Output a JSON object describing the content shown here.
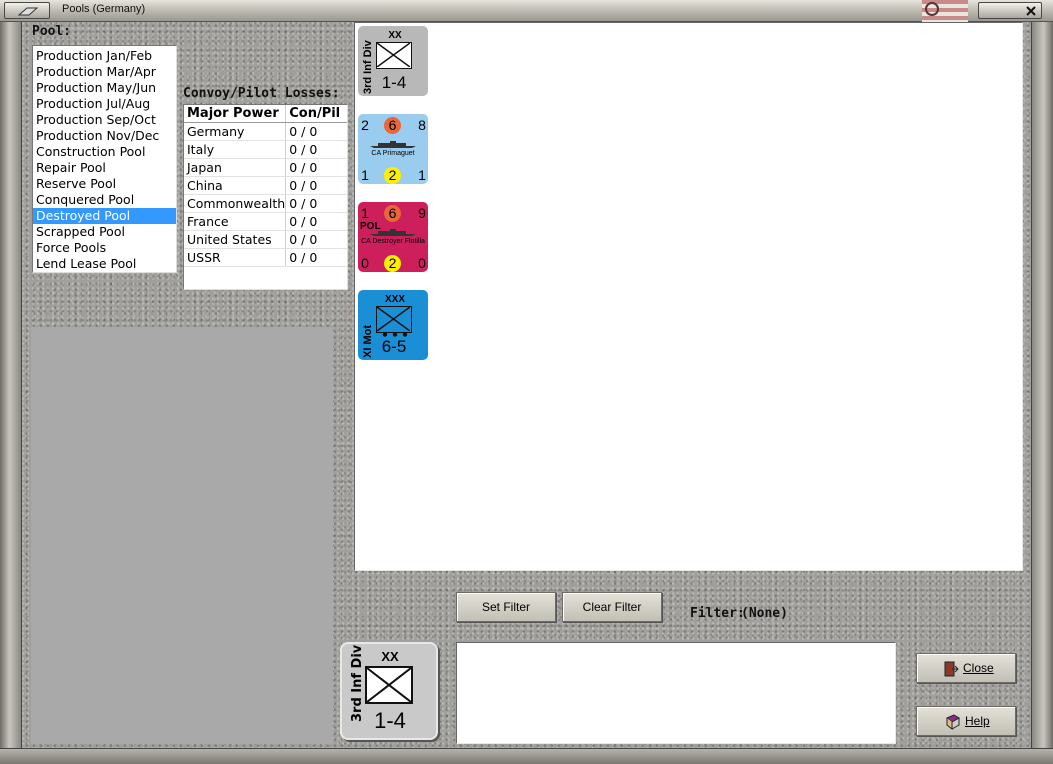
{
  "window": {
    "title": "Pools (Germany)"
  },
  "pool": {
    "label": "Pool:",
    "items": [
      "Production Jan/Feb",
      "Production Mar/Apr",
      "Production May/Jun",
      "Production Jul/Aug",
      "Production Sep/Oct",
      "Production Nov/Dec",
      "Construction Pool",
      "Repair Pool",
      "Reserve Pool",
      "Conquered Pool",
      "Destroyed Pool",
      "Scrapped Pool",
      "Force Pools",
      "Lend Lease Pool"
    ],
    "selected": "Destroyed Pool"
  },
  "convoy": {
    "label": "Convoy/Pilot Losses:",
    "headers": [
      "Major Power",
      "Con/Pil"
    ],
    "rows": [
      [
        "Germany",
        "0 / 0"
      ],
      [
        "Italy",
        "0 / 0"
      ],
      [
        "Japan",
        "0 / 0"
      ],
      [
        "China",
        "0 / 0"
      ],
      [
        "Commonwealth",
        "0 / 0"
      ],
      [
        "France",
        "0 / 0"
      ],
      [
        "United States",
        "0 / 0"
      ],
      [
        "USSR",
        "0 / 0"
      ]
    ]
  },
  "units": [
    {
      "kind": "land",
      "name": "3rd Inf Div",
      "size": "XX",
      "strength": "1-4",
      "color": "#b8b8b8",
      "symbol_bg": "#ffffff"
    },
    {
      "kind": "naval",
      "name": "CA Primaguet",
      "tl": "2",
      "tc": "6",
      "tr": "8",
      "bl": "1",
      "bc": "2",
      "br": "1",
      "color": "#99ccee",
      "flag": ""
    },
    {
      "kind": "naval",
      "name": "CA Destroyer Flotilla",
      "tl": "1",
      "tc": "6",
      "tr": "9",
      "bl": "0",
      "bc": "2",
      "br": "0",
      "color": "#cc1f5c",
      "flag": "POL"
    },
    {
      "kind": "land",
      "name": "XI Mot",
      "size": "XXX",
      "strength": "6-5",
      "color": "#1a8fd6",
      "symbol_bg": "#1a8fd6"
    }
  ],
  "filter": {
    "set_label": "Set Filter",
    "clear_label": "Clear Filter",
    "label": "Filter:",
    "value": "(None)"
  },
  "selected_unit": {
    "name": "3rd Inf Div",
    "size": "XX",
    "strength": "1-4"
  },
  "buttons": {
    "close": "Close",
    "help": "Help"
  },
  "colors": {
    "selection": "#3399ff",
    "naval_top_circle": "#e8663a",
    "naval_bottom_circle": "#ffee00"
  }
}
